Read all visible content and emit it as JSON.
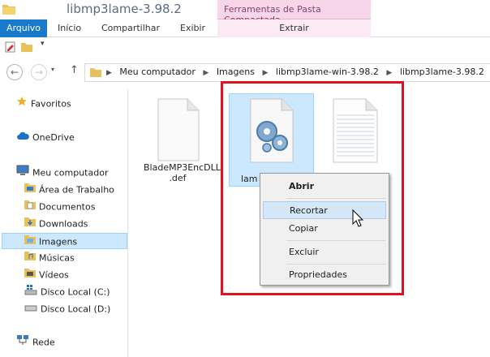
{
  "window": {
    "title": "libmp3lame-3.98.2",
    "context_tab_header": "Ferramentas de Pasta Compactada"
  },
  "ribbon": {
    "tabs": [
      "Arquivo",
      "Início",
      "Compartilhar",
      "Exibir"
    ],
    "context_tab": "Extrair"
  },
  "address": {
    "crumbs": [
      "Meu computador",
      "Imagens",
      "libmp3lame-win-3.98.2",
      "libmp3lame-3.98.2"
    ]
  },
  "nav": {
    "favorites": "Favoritos",
    "onedrive": "OneDrive",
    "computer": "Meu computador",
    "items": [
      "Área de Trabalho",
      "Documentos",
      "Downloads",
      "Imagens",
      "Músicas",
      "Vídeos",
      "Disco Local (C:)",
      "Disco Local (D:)"
    ],
    "network": "Rede"
  },
  "files": [
    {
      "label_line1": "BladeMP3EncDLL",
      "label_line2": ".def",
      "icon": "blank-file-icon"
    },
    {
      "label_line1": "lam",
      "label_line2": "",
      "icon": "dll-gear-file-icon"
    },
    {
      "label_line1": "",
      "label_line2": "",
      "icon": "text-file-icon"
    }
  ],
  "context_menu": {
    "items": [
      "Abrir",
      "Recortar",
      "Copiar",
      "Excluir",
      "Propriedades"
    ]
  },
  "colors": {
    "file_tab": "#1979ca",
    "context_header": "#f7d6ea",
    "selection": "#cce8ff",
    "highlight_border": "#e2111d"
  }
}
